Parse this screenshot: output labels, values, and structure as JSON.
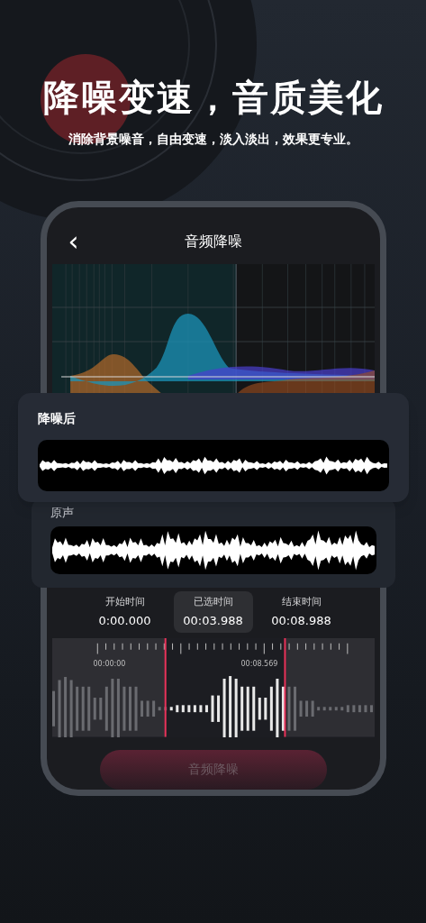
{
  "headline": "降噪变速，音质美化",
  "subtitle": "消除背景噪音，自由变速，淡入淡出，效果更专业。",
  "screen": {
    "back": "‹",
    "title": "音频降噪"
  },
  "cards": [
    {
      "kind": "processed",
      "label": "降噪后"
    },
    {
      "kind": "original",
      "label": "原声"
    }
  ],
  "times": [
    {
      "label": "开始时间",
      "value": "0:00.000",
      "selected": false
    },
    {
      "label": "已选时间",
      "value": "00:03.988",
      "selected": true
    },
    {
      "label": "结束时间",
      "value": "00:08.988",
      "selected": false
    }
  ],
  "timeline": {
    "start_label": "00:00:00",
    "end_label": "00:08.569"
  },
  "action_button": {
    "label": "音频降噪",
    "disabled": true
  }
}
